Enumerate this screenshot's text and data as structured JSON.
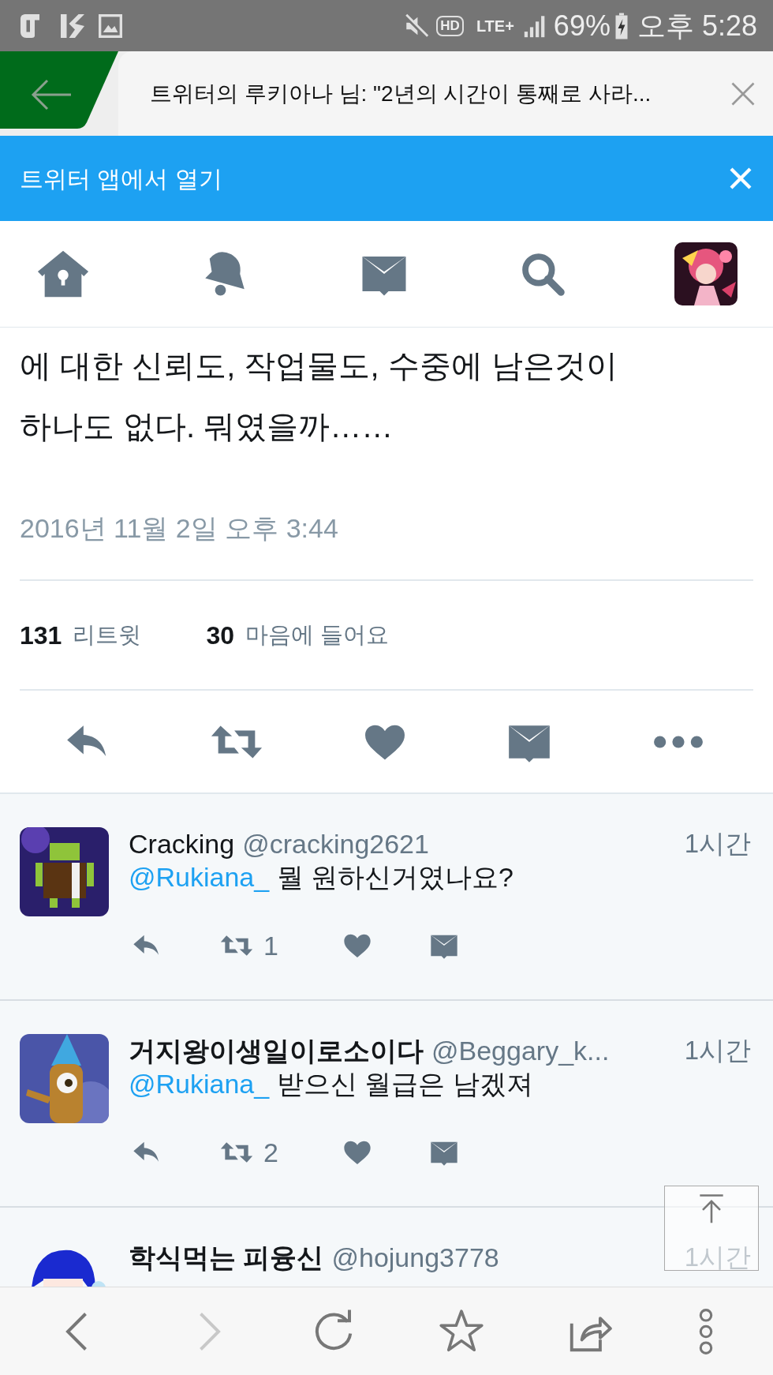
{
  "status_bar": {
    "hd": "HD",
    "network": "LTE+",
    "battery": "69%",
    "time": "오후 5:28"
  },
  "browser_tab": {
    "title": "트위터의 루키아나 님: \"2년의 시간이 통째로 사라..."
  },
  "app_banner": {
    "text": "트위터 앱에서 열기"
  },
  "tweet": {
    "text": "에 대한 신뢰도, 작업물도, 수중에 남은것이\n하나도 없다. 뭐였을까……",
    "timestamp": "2016년 11월 2일 오후 3:44"
  },
  "stats": [
    {
      "count": "131",
      "label": "리트윗"
    },
    {
      "count": "30",
      "label": "마음에 들어요"
    }
  ],
  "replies": [
    {
      "name": "Cracking",
      "handle": "@cracking2621",
      "time": "1시간",
      "mention": "@Rukiana_",
      "text": "뭘 원하신거였나요?",
      "retweets": "1"
    },
    {
      "name": "거지왕이생일이로소이다",
      "handle": "@Beggary_k...",
      "time": "1시간",
      "mention": "@Rukiana_",
      "text": "받으신 월급은 남겠져",
      "retweets": "2"
    },
    {
      "name": "학식먹는 피융신",
      "handle": "@hojung3778",
      "time": "1시간"
    }
  ]
}
